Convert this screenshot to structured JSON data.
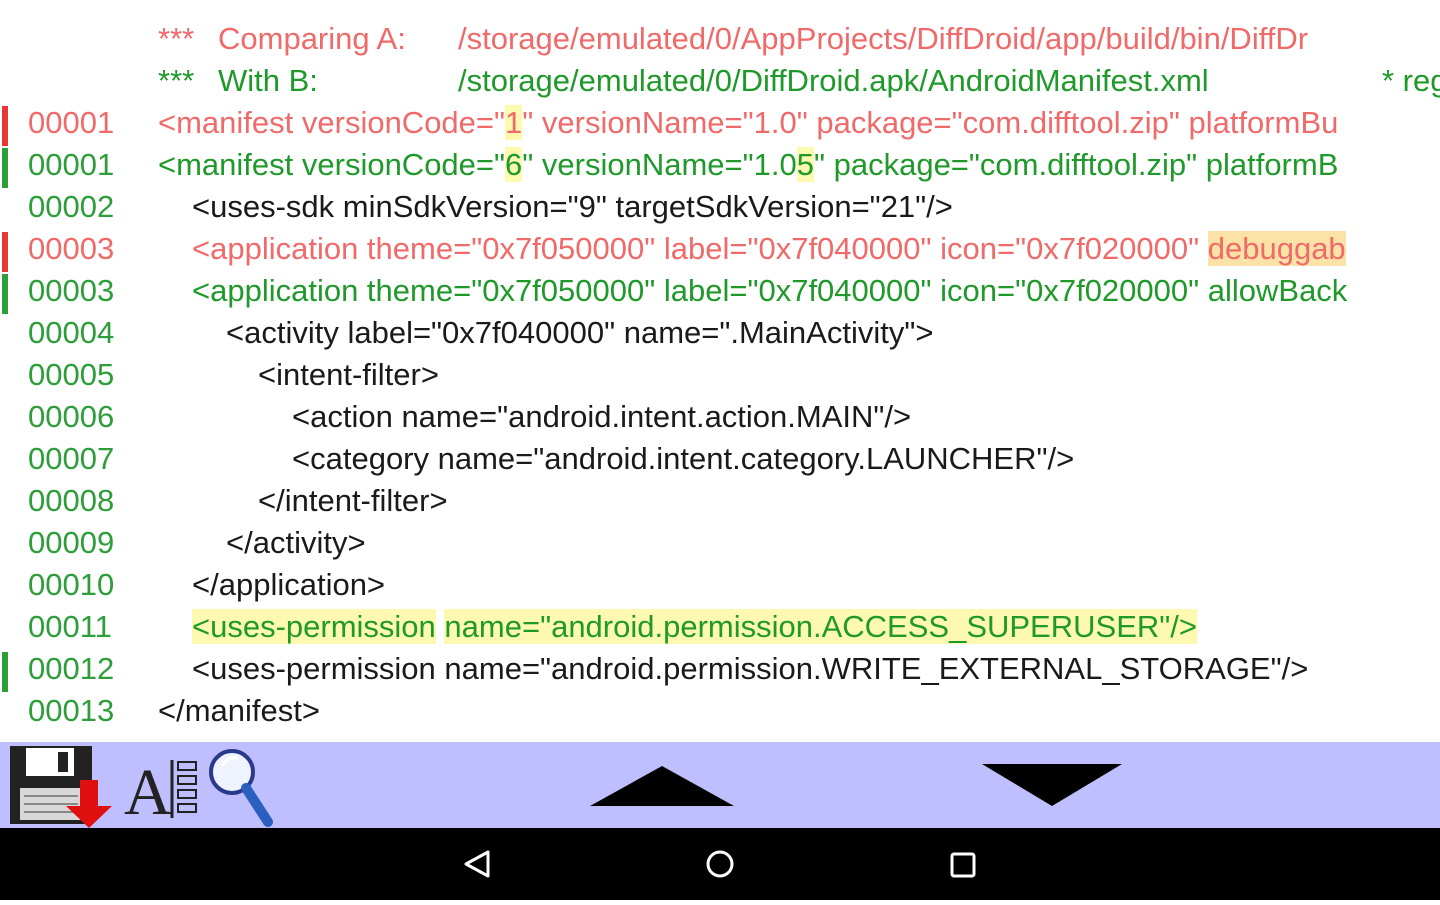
{
  "header": {
    "line_a_stars": "***",
    "line_a_label": "Comparing A:",
    "line_a_path": "/storage/emulated/0/AppProjects/DiffDroid/app/build/bin/DiffDr",
    "line_b_stars": "***",
    "line_b_label": "With B:",
    "line_b_path": "/storage/emulated/0/DiffDroid.apk/AndroidManifest.xml",
    "line_b_extra": "* reg"
  },
  "lines": [
    {
      "num": "00001",
      "status": "removed",
      "segments": [
        "<manifest versionCode=\"",
        "1",
        "\" versionName=\"1.0\" package=\"com.difftool.zip\" platformBu"
      ]
    },
    {
      "num": "00001",
      "status": "added",
      "segments": [
        "<manifest versionCode=\"",
        "6",
        "\" versionName=\"1.0",
        "5",
        "\" package=\"com.difftool.zip\" platformB"
      ]
    },
    {
      "num": "00002",
      "status": "same",
      "text": "<uses-sdk minSdkVersion=\"9\" targetSdkVersion=\"21\"/>"
    },
    {
      "num": "00003",
      "status": "removed",
      "segments": [
        "<application theme=\"0x7f050000\" label=\"0x7f040000\" icon=\"0x7f020000\" ",
        "debuggab"
      ]
    },
    {
      "num": "00003",
      "status": "added",
      "text": "<application theme=\"0x7f050000\" label=\"0x7f040000\" icon=\"0x7f020000\" allowBack"
    },
    {
      "num": "00004",
      "status": "same",
      "text": "<activity label=\"0x7f040000\" name=\".MainActivity\">"
    },
    {
      "num": "00005",
      "status": "same",
      "text": "<intent-filter>"
    },
    {
      "num": "00006",
      "status": "same",
      "text": "<action name=\"android.intent.action.MAIN\"/>"
    },
    {
      "num": "00007",
      "status": "same",
      "text": "<category name=\"android.intent.category.LAUNCHER\"/>"
    },
    {
      "num": "00008",
      "status": "same",
      "text": "</intent-filter>"
    },
    {
      "num": "00009",
      "status": "same",
      "text": "</activity>"
    },
    {
      "num": "00010",
      "status": "same",
      "text": "</application>"
    },
    {
      "num": "00011",
      "status": "added",
      "segments": [
        "<uses-permission",
        " ",
        "name=\"android.permission.ACCESS_SUPERUSER\"/>"
      ]
    },
    {
      "num": "00012",
      "status": "same",
      "text": "<uses-permission name=\"android.permission.WRITE_EXTERNAL_STORAGE\"/>"
    },
    {
      "num": "00013",
      "status": "same",
      "text": "</manifest>"
    }
  ],
  "toolbar": {
    "save_icon": "save-download-icon",
    "font_icon": "font-size-icon",
    "font_icon_text": "A",
    "search_icon": "magnifier-icon",
    "prev_icon": "up-arrow-icon",
    "next_icon": "down-arrow-icon"
  },
  "navbar": {
    "back_icon": "back-triangle-icon",
    "home_icon": "home-circle-icon",
    "recents_icon": "recents-square-icon"
  },
  "colors": {
    "removed": "#f06a6a",
    "added": "#1f9a2a",
    "line_number": "#2e9e3a",
    "highlight": "#fdf9b0",
    "toolbar_bg": "#bfbfff"
  }
}
